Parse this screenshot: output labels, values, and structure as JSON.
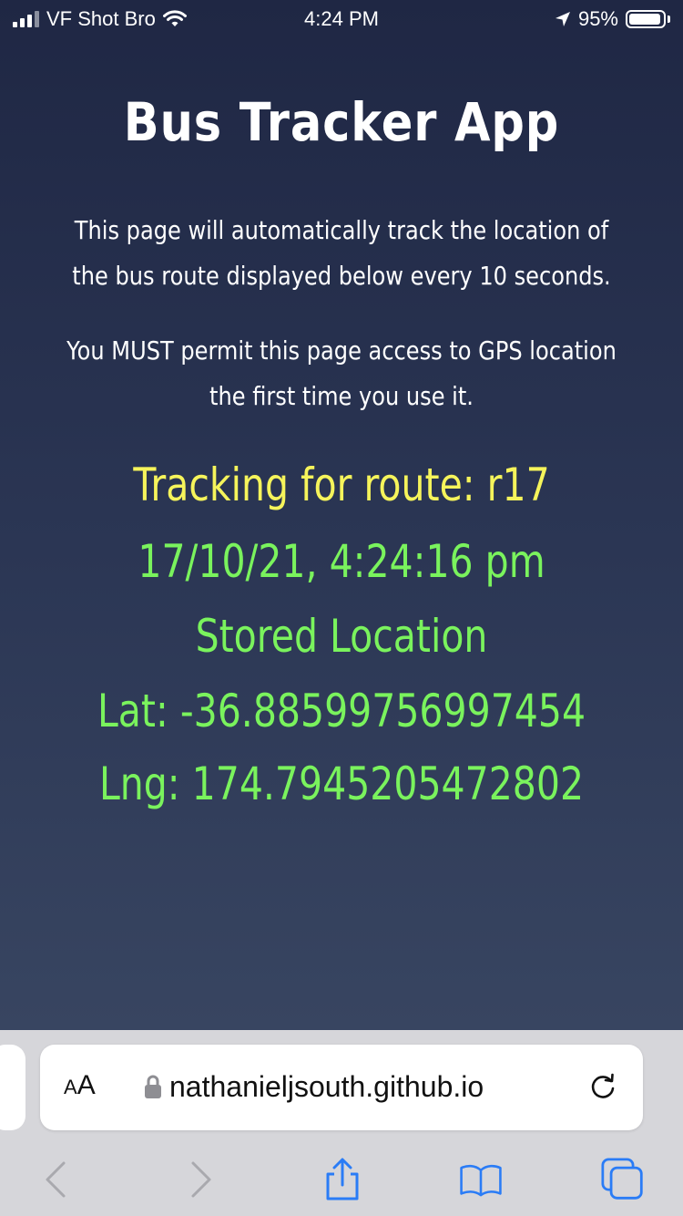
{
  "status_bar": {
    "carrier": "VF Shot Bro",
    "time": "4:24 PM",
    "battery_percent": "95%",
    "battery_level": 0.95
  },
  "page": {
    "title": "Bus Tracker App",
    "intro_1": "This page will automatically track the location of the bus route displayed below every 10 seconds.",
    "intro_2": "You MUST permit this page access to GPS location the first time you use it.",
    "route_line": "Tracking for route: r17",
    "timestamp": "17/10/21, 4:24:16 pm",
    "stored_label": "Stored Location",
    "lat_line": "Lat: -36.88599756997454",
    "lng_line": "Lng: 174.7945205472802"
  },
  "colors": {
    "route_text": "#f6f45b",
    "location_text": "#7af35d",
    "toolbar_blue": "#2a7cf6"
  },
  "browser": {
    "aa_label_small": "A",
    "aa_label_large": "A",
    "url": "nathanieljsouth.github.io",
    "icons": [
      "lock-icon",
      "reload-icon",
      "back-icon",
      "forward-icon",
      "share-icon",
      "bookmarks-icon",
      "tabs-icon"
    ]
  }
}
